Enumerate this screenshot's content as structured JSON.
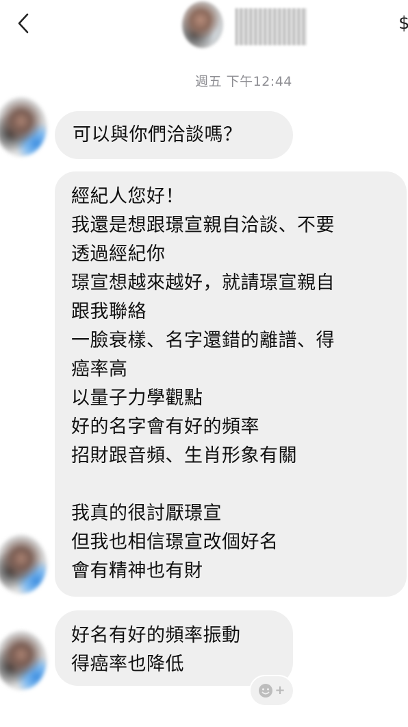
{
  "header": {
    "back_icon": "chevron-left-icon",
    "action_glyph": "$"
  },
  "timestamp": "週五 下午12:44",
  "messages": [
    {
      "lines": [
        "可以與你們洽談嗎？"
      ]
    },
    {
      "lines": [
        "經紀人您好！",
        "我還是想跟璟宣親自洽談、不要",
        "透過經紀你",
        "璟宣想越來越好，就請璟宣親自",
        "跟我聯絡",
        "一臉衰樣、名字還錯的離譜、得",
        "癌率高",
        "以量子力學觀點",
        "好的名字會有好的頻率",
        "招財跟音頻、生肖形象有關",
        "",
        "我真的很討厭璟宣",
        "但我也相信璟宣改個好名",
        "會有精神也有財"
      ]
    },
    {
      "lines": [
        "好名有好的頻率振動",
        "得癌率也降低"
      ]
    }
  ],
  "reaction": {
    "icon": "smiley-icon",
    "plus": "+"
  },
  "colors": {
    "bubble": "#efefef",
    "timestamp": "#8e8e93",
    "text": "#111111"
  }
}
